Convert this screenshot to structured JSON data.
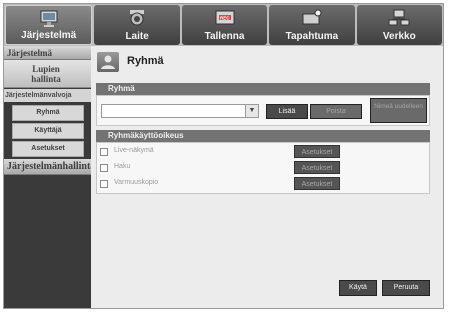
{
  "tabs": [
    {
      "label": "Järjestelmä",
      "icon": "system-monitor-icon",
      "active": true
    },
    {
      "label": "Laite",
      "icon": "camera-icon",
      "active": false
    },
    {
      "label": "Tallenna",
      "icon": "recorder-icon",
      "active": false
    },
    {
      "label": "Tapahtuma",
      "icon": "event-alert-icon",
      "active": false
    },
    {
      "label": "Verkko",
      "icon": "network-icon",
      "active": false
    }
  ],
  "sidebar": {
    "heading": "Järjestelmä",
    "permissions_item": "Lupien hallinta",
    "section": "Järjestelmänvalvoja",
    "items": [
      "Ryhmä",
      "Käyttäjä",
      "Asetukset"
    ],
    "footer": "Järjestelmänhallinta"
  },
  "main": {
    "title": "Ryhmä",
    "group_panel": {
      "heading": "Ryhmä",
      "select_value": "",
      "add_button": "Lisää",
      "delete_button": "Poista",
      "rename_button": "Nimeä uudelleen"
    },
    "permissions_panel": {
      "heading": "Ryhmäkäyttöoikeus",
      "rows": [
        {
          "label": "Live-näkymä",
          "button": "Asetukset"
        },
        {
          "label": "Haku",
          "button": "Asetukset"
        },
        {
          "label": "Varmuuskopio",
          "button": "Asetukset"
        }
      ]
    },
    "apply_button": "Käytä",
    "cancel_button": "Peruuta"
  }
}
